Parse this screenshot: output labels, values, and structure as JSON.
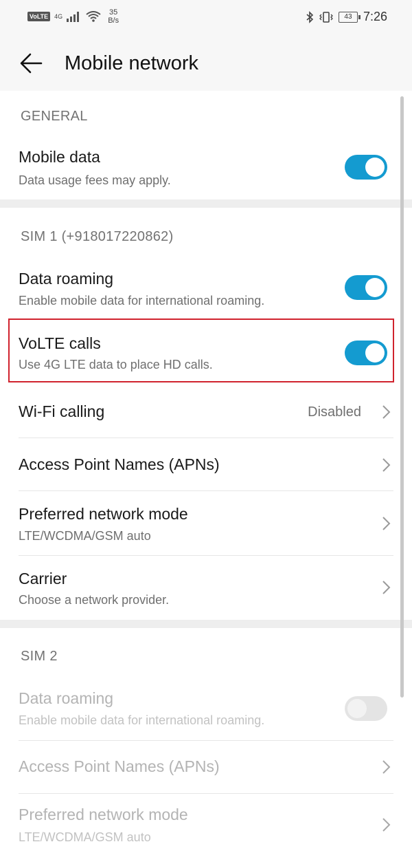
{
  "status_bar": {
    "volte_badge": "VoLTE",
    "network_type": "4G",
    "speed_value": "35",
    "speed_unit": "B/s",
    "battery": "43",
    "time": "7:26"
  },
  "header": {
    "title": "Mobile network"
  },
  "general": {
    "header": "GENERAL",
    "mobile_data": {
      "title": "Mobile data",
      "subtitle": "Data usage fees may apply.",
      "enabled": true
    }
  },
  "sim1": {
    "header": "SIM 1 (+918017220862)",
    "data_roaming": {
      "title": "Data roaming",
      "subtitle": "Enable mobile data for international roaming.",
      "enabled": true
    },
    "volte": {
      "title": "VoLTE calls",
      "subtitle": "Use 4G LTE data to place HD calls.",
      "enabled": true
    },
    "wifi_calling": {
      "title": "Wi-Fi calling",
      "value": "Disabled"
    },
    "apn": {
      "title": "Access Point Names (APNs)"
    },
    "network_mode": {
      "title": "Preferred network mode",
      "subtitle": "LTE/WCDMA/GSM auto"
    },
    "carrier": {
      "title": "Carrier",
      "subtitle": "Choose a network provider."
    }
  },
  "sim2": {
    "header": "SIM 2",
    "data_roaming": {
      "title": "Data roaming",
      "subtitle": "Enable mobile data for international roaming.",
      "enabled": false
    },
    "apn": {
      "title": "Access Point Names (APNs)"
    },
    "network_mode": {
      "title": "Preferred network mode",
      "subtitle": "LTE/WCDMA/GSM auto"
    }
  },
  "colors": {
    "accent": "#149bd0",
    "highlight_border": "#d0222d"
  }
}
